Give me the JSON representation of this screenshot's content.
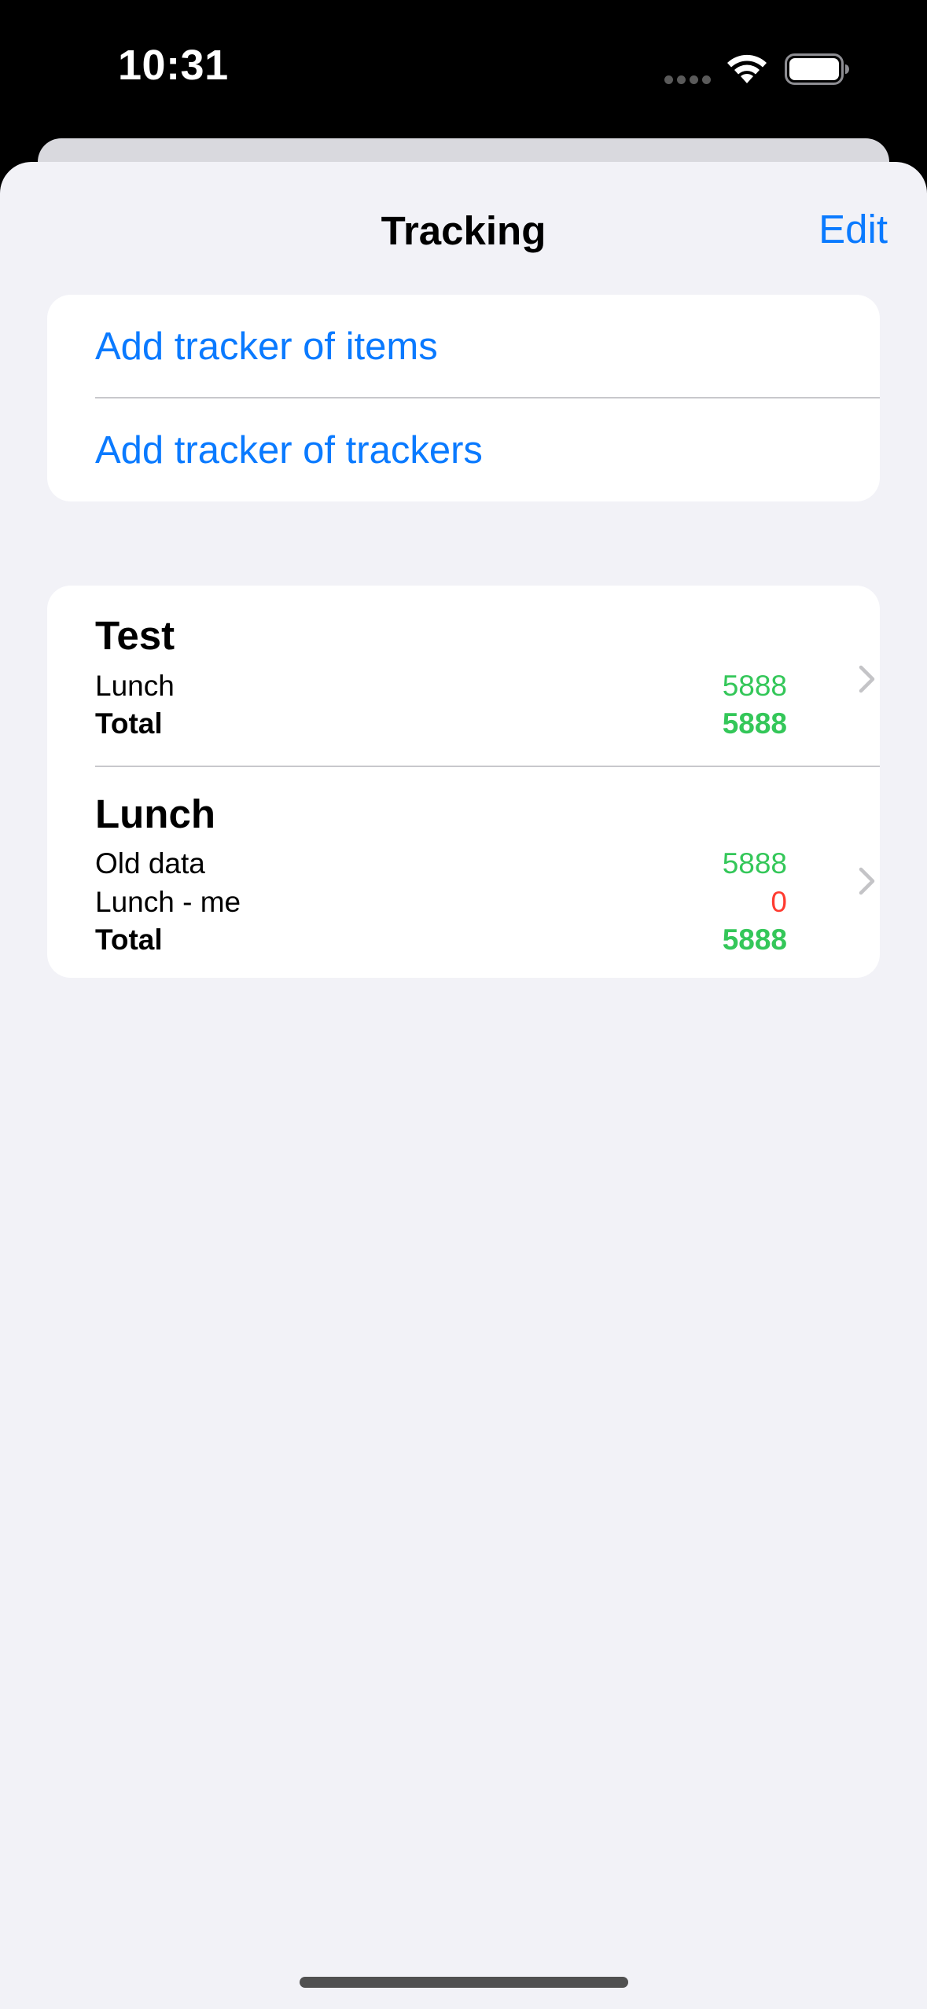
{
  "status_bar": {
    "time": "10:31"
  },
  "nav": {
    "title": "Tracking",
    "edit_label": "Edit"
  },
  "actions": [
    {
      "label": "Add tracker of items"
    },
    {
      "label": "Add tracker of trackers"
    }
  ],
  "trackers": [
    {
      "title": "Test",
      "entries": [
        {
          "name": "Lunch",
          "value": "5888",
          "status": "positive"
        }
      ],
      "total": {
        "name": "Total",
        "value": "5888",
        "status": "positive"
      }
    },
    {
      "title": "Lunch",
      "entries": [
        {
          "name": "Old data",
          "value": "5888",
          "status": "positive"
        },
        {
          "name": "Lunch - me",
          "value": "0",
          "status": "negative"
        }
      ],
      "total": {
        "name": "Total",
        "value": "5888",
        "status": "positive"
      }
    }
  ],
  "colors": {
    "accent": "#0a7aff",
    "positive": "#34c759",
    "negative": "#ff3b30",
    "background": "#f2f2f7",
    "card": "#ffffff",
    "chevron": "#c4c4c7"
  },
  "icons": {
    "signal": "cellular-signal-icon",
    "wifi": "wifi-icon",
    "battery": "battery-icon",
    "disclosure": "chevron-right-icon"
  }
}
